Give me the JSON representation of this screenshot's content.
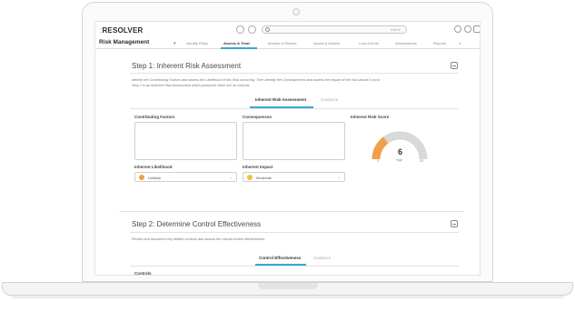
{
  "app": {
    "logo": "RESOLVER",
    "logo_mark": ":",
    "name": "Risk Management",
    "search_hint": "Ctrl+K"
  },
  "nav": {
    "tabs": [
      {
        "label": "Identify Risks",
        "active": false
      },
      {
        "label": "Assess & Treat",
        "active": true
      },
      {
        "label": "Monitor & Review",
        "active": false
      },
      {
        "label": "Issues & Actions",
        "active": false
      },
      {
        "label": "Loss Events",
        "active": false
      },
      {
        "label": "Assessments",
        "active": false
      },
      {
        "label": "Reports",
        "active": false
      }
    ],
    "more": "∨"
  },
  "step1": {
    "title": "Step 1: Inherent Risk Assessment",
    "desc_line1": "Identify the Contributing Factors and assess the Likelihood of this Risk occurring. Then identify the Consequences and assess the impact of the risk should it occur.",
    "desc_line2": "Step 1 is an Inherent Risk Assessment which presumes there are no controls.",
    "tabs": [
      "Inherent Risk Assessment",
      "Guidance"
    ],
    "contributing_label": "Contributing Factors",
    "consequences_label": "Consequences",
    "score_label": "Inherent Risk Score",
    "score_value": "6",
    "score_level": "High",
    "gauge_min": "0",
    "gauge_max": "20",
    "gauge_fraction": 0.3,
    "likelihood_label": "Inherent Likelihood",
    "likelihood_value": "Unlikely",
    "impact_label": "Inherent Impact",
    "impact_value": "Moderate"
  },
  "step2": {
    "title": "Step 2: Determine Control Effectiveness",
    "desc": "Review and document any related controls and assess the overall control effectiveness.",
    "tabs": [
      "Control Effectiveness",
      "Guidance"
    ],
    "controls_label": "Controls"
  },
  "colors": {
    "accent": "#3ba7d8",
    "gauge_fill": "#f0a04b",
    "gauge_track": "#d9d9d9",
    "likelihood_dot": "#f0a04b",
    "impact_dot": "#f0c04b"
  }
}
